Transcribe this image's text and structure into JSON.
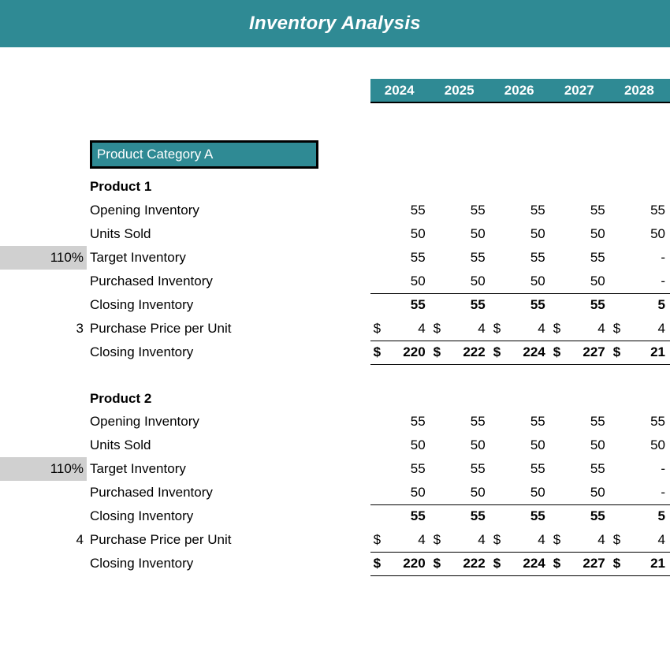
{
  "banner_title": "Inventory Analysis",
  "years": [
    "2024",
    "2025",
    "2026",
    "2027",
    "2028"
  ],
  "category_label": "Product Category A",
  "chart_data": {
    "type": "table",
    "products": [
      {
        "name": "Product 1",
        "rows": [
          {
            "key": "opening",
            "prefix": "",
            "label": "Opening Inventory",
            "sym": "",
            "values": [
              "55",
              "55",
              "55",
              "55",
              "55"
            ],
            "style": ""
          },
          {
            "key": "unitssold",
            "prefix": "",
            "label": "Units Sold",
            "sym": "",
            "values": [
              "50",
              "50",
              "50",
              "50",
              "50"
            ],
            "style": ""
          },
          {
            "key": "target",
            "prefix": "110%",
            "label": "Target Inventory",
            "sym": "",
            "values": [
              "55",
              "55",
              "55",
              "55",
              "-"
            ],
            "style": "grey"
          },
          {
            "key": "purchased",
            "prefix": "",
            "label": "Purchased Inventory",
            "sym": "",
            "values": [
              "50",
              "50",
              "50",
              "50",
              "-"
            ],
            "style": ""
          },
          {
            "key": "closingu",
            "prefix": "",
            "label": "Closing Inventory",
            "sym": "",
            "values": [
              "55",
              "55",
              "55",
              "55",
              "5"
            ],
            "style": "sum-top bold"
          },
          {
            "key": "price",
            "prefix": "3",
            "label": "Purchase Price per Unit",
            "sym": "$",
            "values": [
              "4",
              "4",
              "4",
              "4",
              "4"
            ],
            "style": ""
          },
          {
            "key": "closingv",
            "prefix": "",
            "label": "Closing Inventory",
            "sym": "$",
            "values": [
              "220",
              "222",
              "224",
              "227",
              "21"
            ],
            "style": "sum-tb bold"
          }
        ]
      },
      {
        "name": "Product 2",
        "rows": [
          {
            "key": "opening",
            "prefix": "",
            "label": "Opening Inventory",
            "sym": "",
            "values": [
              "55",
              "55",
              "55",
              "55",
              "55"
            ],
            "style": ""
          },
          {
            "key": "unitssold",
            "prefix": "",
            "label": "Units Sold",
            "sym": "",
            "values": [
              "50",
              "50",
              "50",
              "50",
              "50"
            ],
            "style": ""
          },
          {
            "key": "target",
            "prefix": "110%",
            "label": "Target Inventory",
            "sym": "",
            "values": [
              "55",
              "55",
              "55",
              "55",
              "-"
            ],
            "style": "grey"
          },
          {
            "key": "purchased",
            "prefix": "",
            "label": "Purchased Inventory",
            "sym": "",
            "values": [
              "50",
              "50",
              "50",
              "50",
              "-"
            ],
            "style": ""
          },
          {
            "key": "closingu",
            "prefix": "",
            "label": "Closing Inventory",
            "sym": "",
            "values": [
              "55",
              "55",
              "55",
              "55",
              "5"
            ],
            "style": "sum-top bold"
          },
          {
            "key": "price",
            "prefix": "4",
            "label": "Purchase Price per Unit",
            "sym": "$",
            "values": [
              "4",
              "4",
              "4",
              "4",
              "4"
            ],
            "style": ""
          },
          {
            "key": "closingv",
            "prefix": "",
            "label": "Closing Inventory",
            "sym": "$",
            "values": [
              "220",
              "222",
              "224",
              "227",
              "21"
            ],
            "style": "sum-tb bold"
          }
        ]
      }
    ]
  }
}
